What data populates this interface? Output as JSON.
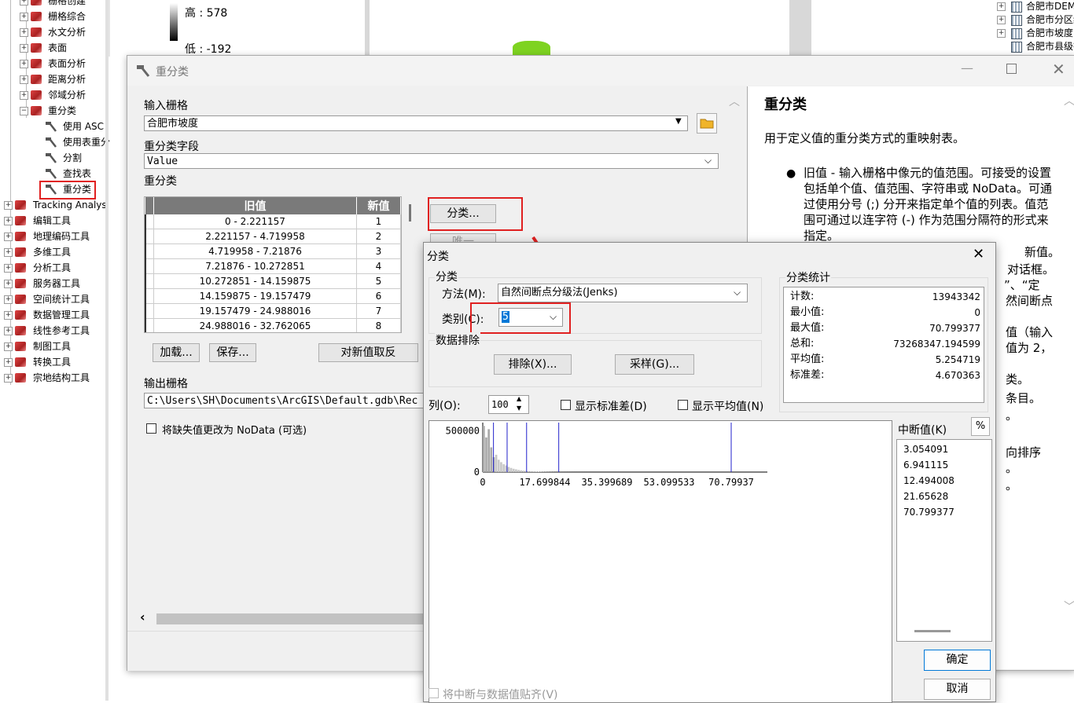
{
  "toolbox": {
    "items": [
      {
        "label": "栅格创建",
        "level": 1,
        "icon": "toolbox-icon",
        "expand": "+"
      },
      {
        "label": "栅格综合",
        "level": 1,
        "icon": "toolbox-icon",
        "expand": "+"
      },
      {
        "label": "水文分析",
        "level": 1,
        "icon": "toolbox-icon",
        "expand": "+"
      },
      {
        "label": "表面",
        "level": 1,
        "icon": "toolbox-icon",
        "expand": "+"
      },
      {
        "label": "表面分析",
        "level": 1,
        "icon": "toolbox-icon",
        "expand": "+"
      },
      {
        "label": "距离分析",
        "level": 1,
        "icon": "toolbox-icon",
        "expand": "+"
      },
      {
        "label": "邻域分析",
        "level": 1,
        "icon": "toolbox-icon",
        "expand": "+"
      },
      {
        "label": "重分类",
        "level": 1,
        "icon": "toolbox-icon",
        "expand": "−"
      },
      {
        "label": "使用 ASC",
        "level": 2,
        "icon": "hammer-icon"
      },
      {
        "label": "使用表重分",
        "level": 2,
        "icon": "hammer-icon"
      },
      {
        "label": "分割",
        "level": 2,
        "icon": "hammer-icon"
      },
      {
        "label": "查找表",
        "level": 2,
        "icon": "hammer-icon"
      },
      {
        "label": "重分类",
        "level": 2,
        "icon": "hammer-icon"
      },
      {
        "label": "Tracking Analys",
        "level": 0,
        "icon": "toolbox-icon",
        "expand": "+"
      },
      {
        "label": "编辑工具",
        "level": 0,
        "icon": "toolbox-icon",
        "expand": "+"
      },
      {
        "label": "地理编码工具",
        "level": 0,
        "icon": "toolbox-icon",
        "expand": "+"
      },
      {
        "label": "多维工具",
        "level": 0,
        "icon": "toolbox-icon",
        "expand": "+"
      },
      {
        "label": "分析工具",
        "level": 0,
        "icon": "toolbox-icon",
        "expand": "+"
      },
      {
        "label": "服务器工具",
        "level": 0,
        "icon": "toolbox-icon",
        "expand": "+"
      },
      {
        "label": "空间统计工具",
        "level": 0,
        "icon": "toolbox-icon",
        "expand": "+"
      },
      {
        "label": "数据管理工具",
        "level": 0,
        "icon": "toolbox-icon",
        "expand": "+"
      },
      {
        "label": "线性参考工具",
        "level": 0,
        "icon": "toolbox-icon",
        "expand": "+"
      },
      {
        "label": "制图工具",
        "level": 0,
        "icon": "toolbox-icon",
        "expand": "+"
      },
      {
        "label": "转换工具",
        "level": 0,
        "icon": "toolbox-icon",
        "expand": "+"
      },
      {
        "label": "宗地结构工具",
        "level": 0,
        "icon": "toolbox-icon",
        "expand": "+"
      }
    ]
  },
  "legend": {
    "high": "高 : 578",
    "low": "低 : -192"
  },
  "layers": [
    {
      "label": "合肥市DEM_投影",
      "expand": "+"
    },
    {
      "label": "合肥市分区统计",
      "expand": "+"
    },
    {
      "label": "合肥市坡度",
      "expand": "+"
    },
    {
      "label": "合肥市县级行政区_投影",
      "expand": ""
    }
  ],
  "main": {
    "title": "重分类",
    "input_label": "输入栅格",
    "input_value": "合肥市坡度",
    "field_label": "重分类字段",
    "field_value": "Value",
    "reclass_label": "重分类",
    "table": {
      "headers": [
        "旧值",
        "新值"
      ],
      "rows": [
        [
          "0 - 2.221157",
          "1"
        ],
        [
          "2.221157 - 4.719958",
          "2"
        ],
        [
          "4.719958 - 7.21876",
          "3"
        ],
        [
          "7.21876 - 10.272851",
          "4"
        ],
        [
          "10.272851 - 14.159875",
          "5"
        ],
        [
          "14.159875 - 19.157479",
          "6"
        ],
        [
          "19.157479 - 24.988016",
          "7"
        ],
        [
          "24.988016 - 32.762065",
          "8"
        ]
      ]
    },
    "classify_button": "分类...",
    "unique_button": "唯一",
    "load_button": "加载...",
    "save_button": "保存...",
    "reverse_button": "对新值取反",
    "output_label": "输出栅格",
    "output_value": "C:\\Users\\SH\\Documents\\ArcGIS\\Default.gdb\\Rec",
    "nodata_label": "将缺失值更改为 NoData (可选)"
  },
  "help": {
    "title": "重分类",
    "intro": "用于定义值的重分类方式的重映射表。",
    "bullet": "旧值 - 输入栅格中像元的值范围。可接受的设置包括单个值、值范围、字符串或 NoData。可通过使用分号 (;) 分开来指定单个值的列表。值范围可通过以连字符 (-) 作为范围分隔符的形式来指定。",
    "frag1": "新值。",
    "frag2": "对话框。",
    "frag3": "”、“定",
    "frag4": "然间断点",
    "frag5": "值（输入",
    "frag6": "值为 2，",
    "frag7": "类。",
    "frag8": "条目。",
    "frag9": "。",
    "frag10": "向排序",
    "frag11": "。",
    "frag12": "。"
  },
  "classify": {
    "title": "分类",
    "group_label": "分类",
    "method_label": "方法(M):",
    "method_value": "自然间断点分级法(Jenks)",
    "classes_label": "类别(C):",
    "classes_value": "5",
    "exclusion_label": "数据排除",
    "exclusion_button": "排除(X)...",
    "sampling_button": "采样(G)...",
    "columns_label": "列(O):",
    "columns_value": "100",
    "show_std_label": "显示标准差(D)",
    "show_mean_label": "显示平均值(N)",
    "stats_label": "分类统计",
    "stats": [
      {
        "k": "计数:",
        "v": "13943342"
      },
      {
        "k": "最小值:",
        "v": "0"
      },
      {
        "k": "最大值:",
        "v": "70.799377"
      },
      {
        "k": "总和:",
        "v": "73268347.194599"
      },
      {
        "k": "平均值:",
        "v": "5.254719"
      },
      {
        "k": "标准差:",
        "v": "4.670363"
      }
    ],
    "breaks_label": "中断值(K)",
    "percent_button": "%",
    "breaks": [
      "3.054091",
      "6.941115",
      "12.494008",
      "21.65628",
      "70.799377"
    ],
    "ok_button": "确定",
    "cancel_button": "取消",
    "snap_label": "将中断与数据值贴齐(V)",
    "histogram": {
      "y_ticks": [
        "500000",
        "0"
      ],
      "x_ticks": [
        "0",
        "17.699844",
        "35.399689",
        "53.099533",
        "70.79937"
      ],
      "x_max": 70.799377,
      "y_max": 600000,
      "breaks": [
        3.054091,
        6.941115,
        12.494008,
        21.65628,
        70.799377
      ],
      "bins": [
        560000,
        420000,
        520000,
        300000,
        180000,
        210000,
        150000,
        120000,
        95000,
        80000,
        62000,
        50000,
        40000,
        33000,
        26000,
        21000,
        17000,
        14000,
        11000,
        9000,
        7500,
        6000,
        5000,
        4000,
        3300,
        2700,
        2200,
        1800,
        1500,
        1200,
        1000,
        800,
        650,
        520,
        420,
        340,
        280,
        230,
        190,
        150,
        120,
        100,
        80,
        65,
        50,
        40,
        32,
        26,
        20,
        16
      ]
    }
  },
  "colors": {
    "accent": "#0078d7",
    "highlight": "#e02020",
    "green": "#7ed321"
  }
}
